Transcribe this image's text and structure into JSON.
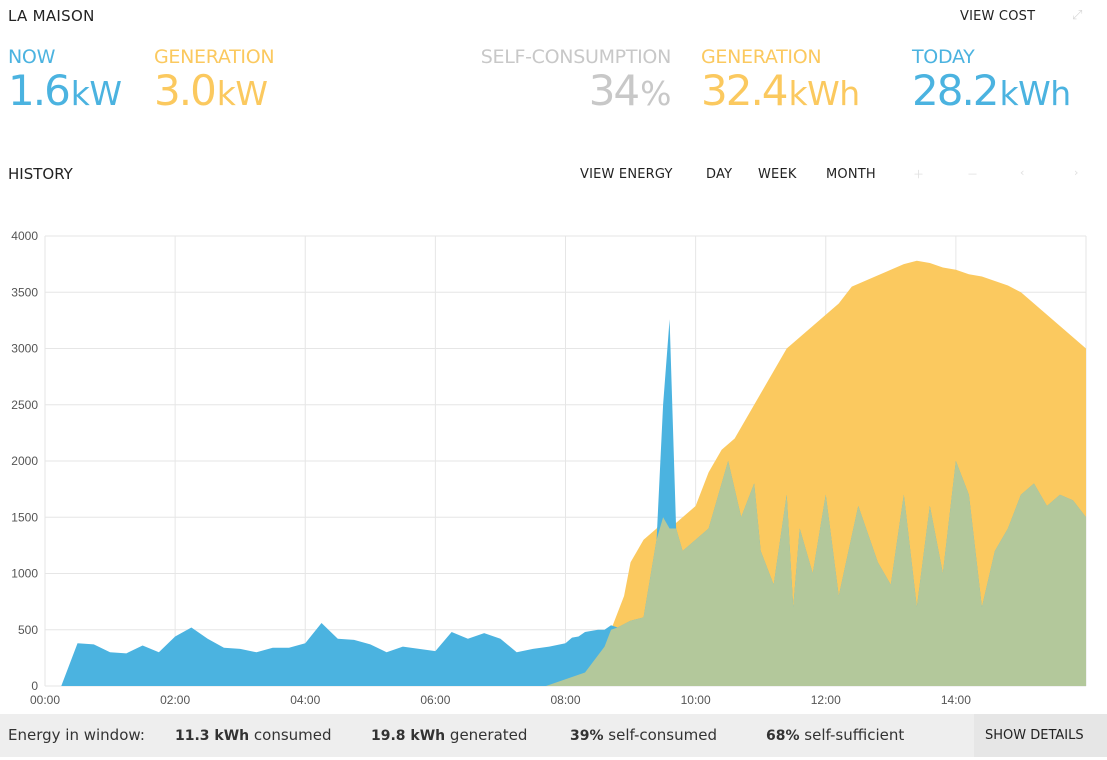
{
  "header": {
    "title": "LA MAISON",
    "view_cost": "VIEW COST"
  },
  "metrics": {
    "now": {
      "label": "NOW",
      "value": "1.6",
      "unit": "kW"
    },
    "generation_now": {
      "label": "GENERATION",
      "value": "3.0",
      "unit": "kW"
    },
    "self_consumption": {
      "label": "SELF-CONSUMPTION",
      "value": "34",
      "unit": "%"
    },
    "generation_today": {
      "label": "GENERATION",
      "value": "32.4",
      "unit": "kWh"
    },
    "today": {
      "label": "TODAY",
      "value": "28.2",
      "unit": "kWh"
    }
  },
  "history": {
    "title": "HISTORY",
    "view_energy": "VIEW ENERGY",
    "day": "DAY",
    "week": "WEEK",
    "month": "MONTH"
  },
  "footer": {
    "label": "Energy in window:",
    "consumed_value": "11.3 kWh",
    "consumed_text": "consumed",
    "generated_value": "19.8 kWh",
    "generated_text": "generated",
    "self_consumed_value": "39%",
    "self_consumed_text": "self-consumed",
    "self_sufficient_value": "68%",
    "self_sufficient_text": "self-sufficient",
    "show_details": "SHOW DETAILS"
  },
  "colors": {
    "consumption": "#4bb3e0",
    "generation": "#fbc95f",
    "self_consumed": "#b3c89b"
  },
  "chart_data": {
    "type": "area",
    "x_unit": "hours",
    "xlim": [
      0,
      16
    ],
    "ylim": [
      0,
      4000
    ],
    "x_ticks": [
      "00:00",
      "02:00",
      "04:00",
      "06:00",
      "08:00",
      "10:00",
      "12:00",
      "14:00"
    ],
    "y_ticks": [
      0,
      500,
      1000,
      1500,
      2000,
      2500,
      3000,
      3500,
      4000
    ],
    "grid": true,
    "series": [
      {
        "key": "consumption",
        "x": [
          0.25,
          0.5,
          0.75,
          1.0,
          1.25,
          1.5,
          1.75,
          2.0,
          2.25,
          2.5,
          2.75,
          3.0,
          3.25,
          3.5,
          3.75,
          4.0,
          4.25,
          4.5,
          4.75,
          5.0,
          5.25,
          5.5,
          5.75,
          6.0,
          6.25,
          6.5,
          6.75,
          7.0,
          7.25,
          7.5,
          7.75,
          8.0,
          8.1,
          8.2,
          8.3,
          8.5,
          8.6,
          8.7,
          8.8,
          9.0,
          9.2,
          9.4,
          9.5,
          9.6,
          9.7,
          9.8,
          10.0,
          10.2,
          10.3,
          10.5,
          10.7,
          10.9,
          11.0,
          11.2,
          11.4,
          11.5,
          11.6,
          11.8,
          12.0,
          12.2,
          12.5,
          12.8,
          13.0,
          13.2,
          13.4,
          13.6,
          13.8,
          14.0,
          14.2,
          14.4,
          14.6,
          14.8,
          15.0,
          15.2,
          15.4,
          15.6,
          15.8,
          16.0
        ],
        "y": [
          0,
          380,
          370,
          300,
          290,
          360,
          300,
          440,
          520,
          420,
          340,
          330,
          300,
          340,
          340,
          380,
          560,
          420,
          410,
          370,
          300,
          350,
          330,
          310,
          480,
          420,
          470,
          420,
          300,
          330,
          350,
          380,
          430,
          440,
          480,
          500,
          500,
          540,
          520,
          580,
          610,
          1300,
          2500,
          3260,
          1400,
          1200,
          1300,
          1400,
          1600,
          2000,
          1500,
          1800,
          1200,
          900,
          1700,
          700,
          1400,
          1000,
          1700,
          800,
          1600,
          1100,
          900,
          1700,
          700,
          1600,
          1000,
          2000,
          1700,
          700,
          1200,
          1400,
          1700,
          1800,
          1600,
          1700,
          1650,
          1500
        ]
      },
      {
        "key": "generation",
        "x": [
          7.7,
          8.0,
          8.3,
          8.6,
          8.9,
          9.0,
          9.2,
          9.4,
          9.5,
          9.6,
          9.8,
          10.0,
          10.2,
          10.4,
          10.6,
          10.8,
          11.0,
          11.2,
          11.4,
          11.6,
          11.8,
          12.0,
          12.2,
          12.4,
          12.6,
          12.8,
          13.0,
          13.2,
          13.4,
          13.6,
          13.8,
          14.0,
          14.2,
          14.4,
          14.6,
          14.8,
          15.0,
          15.2,
          15.4,
          15.6,
          15.8,
          16.0
        ],
        "y": [
          0,
          60,
          120,
          350,
          800,
          1100,
          1300,
          1400,
          1500,
          1400,
          1500,
          1600,
          1900,
          2100,
          2200,
          2400,
          2600,
          2800,
          3000,
          3100,
          3200,
          3300,
          3400,
          3550,
          3600,
          3650,
          3700,
          3750,
          3780,
          3760,
          3720,
          3700,
          3660,
          3640,
          3600,
          3560,
          3500,
          3400,
          3300,
          3200,
          3100,
          3000
        ]
      }
    ]
  }
}
